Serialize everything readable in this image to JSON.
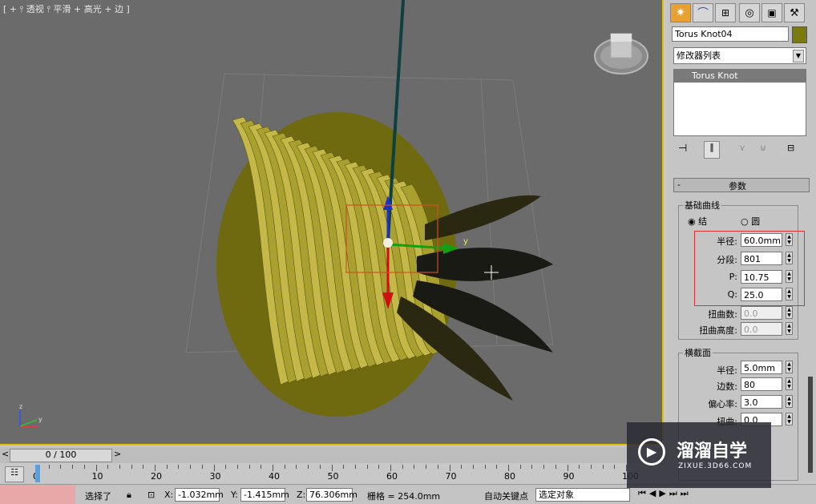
{
  "viewport": {
    "label": "[ + ⫯ 透视 ⫯ 平滑 + 高光 + 边 ]",
    "axis_y": "y",
    "axis_z": "z",
    "gizmo_z": "z",
    "gizmo_y": "y"
  },
  "panel": {
    "object_name": "Torus Knot04",
    "object_color": "#7a7a10",
    "modifier_list": "修改器列表",
    "stack_item": "Torus Knot",
    "rollout_title": "参数",
    "base_curve": {
      "title": "基础曲线",
      "radio_knot": "结",
      "radio_circle": "圆",
      "radius_label": "半径:",
      "radius": "60.0mm",
      "segments_label": "分段:",
      "segments": "801",
      "p_label": "P:",
      "p": "10.75",
      "q_label": "Q:",
      "q": "25.0",
      "warp_count_label": "扭曲数:",
      "warp_count": "0.0",
      "warp_height_label": "扭曲高度:",
      "warp_height": "0.0"
    },
    "cross_section": {
      "title": "横截面",
      "radius_label": "半径:",
      "radius": "5.0mm",
      "sides_label": "边数:",
      "sides": "80",
      "eccentricity_label": "偏心率:",
      "eccentricity": "3.0",
      "twist_label": "扭曲:",
      "twist": "0.0"
    }
  },
  "timeline": {
    "frame_label": "0 / 100",
    "prev": "<",
    "next": ">",
    "ticks": [
      "0",
      "10",
      "20",
      "30",
      "40",
      "50",
      "60",
      "70",
      "80",
      "90",
      "100"
    ]
  },
  "status": {
    "selected": "选择了",
    "x_label": "X:",
    "x": "-1.032mm",
    "y_label": "Y:",
    "y": "-1.415mm",
    "z_label": "Z:",
    "z": "76.306mm",
    "grid": "栅格 = 254.0mm",
    "auto_key": "自动关键点",
    "selection_set": "选定对象"
  },
  "watermark": {
    "brand": "溜溜自学",
    "url": "ZIXUE.3D66.COM"
  }
}
